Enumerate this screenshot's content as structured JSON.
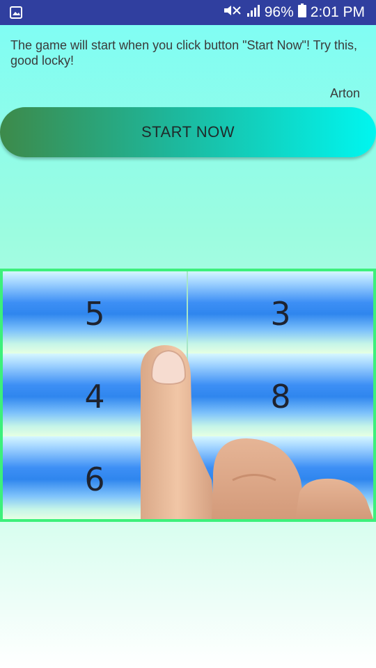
{
  "status_bar": {
    "battery_percent": "96%",
    "time": "2:01 PM",
    "icons": [
      "gallery-icon",
      "mute-icon",
      "signal-icon",
      "battery-icon"
    ]
  },
  "intro_text": "The game will start when you click button \"Start Now\"! Try this, good locky!",
  "author": "Arton",
  "start_button_label": "START NOW",
  "grid": {
    "cells": [
      "5",
      "3",
      "4",
      "8",
      "6",
      ""
    ]
  },
  "colors": {
    "status_bar": "#303f9f",
    "frame_border": "#3df07b",
    "button_start": "#3d8a4a",
    "button_end": "#00f6f0"
  }
}
